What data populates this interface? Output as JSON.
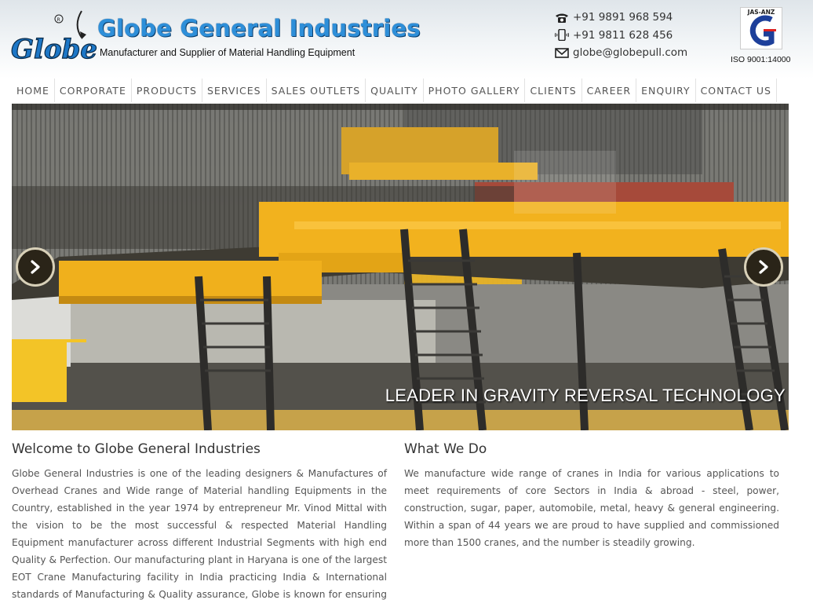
{
  "header": {
    "brand_name": "Globe General Industries",
    "logo_text": "Globe",
    "tagline": "Manufacturer and Supplier of Material Handling Equipment",
    "phone1": "+91 9891 968 594",
    "phone2": "+91 9811 628 456",
    "email": "globe@globepull.com",
    "cert_label": "JAS-ANZ",
    "iso": "ISO 9001:14000"
  },
  "nav": {
    "items": [
      "HOME",
      "CORPORATE",
      "PRODUCTS",
      "SERVICES",
      "SALES OUTLETS",
      "QUALITY",
      "PHOTO GALLERY",
      "CLIENTS",
      "CAREER",
      "ENQUIRY",
      "CONTACT US"
    ]
  },
  "slider": {
    "caption": "LEADER IN GRAVITY REVERSAL TECHNOLOGY"
  },
  "welcome": {
    "title": "Welcome to Globe General Industries",
    "body": "Globe General Industries is one of  the leading designers & Manufactures of Overhead Cranes and Wide range of Material handling Equipments in the Country, established in the year 1974 by entrepreneur Mr. Vinod Mittal with the vision to be the most successful & respected Material Handling Equipment manufacturer across different Industrial Segments with high end Quality & Perfection. Our manufacturing plant in Haryana is one of the largest EOT Crane Manufacturing facility in India practicing India & International standards  of Manufacturing & Quality assurance, Globe is known for ensuring service excellence."
  },
  "what_we_do": {
    "title": "What We Do",
    "body": "We manufacture wide range of cranes in India for various applications to meet requirements of core Sectors in India & abroad - steel, power, construction, sugar, paper, automobile, metal, heavy & general engineering. Within a span of 44 years we are proud to have supplied and commissioned more than 1500 cranes, and the number is steadily growing."
  },
  "colors": {
    "brand_blue": "#2e8fd9",
    "crane_yellow": "#f2b21e"
  }
}
